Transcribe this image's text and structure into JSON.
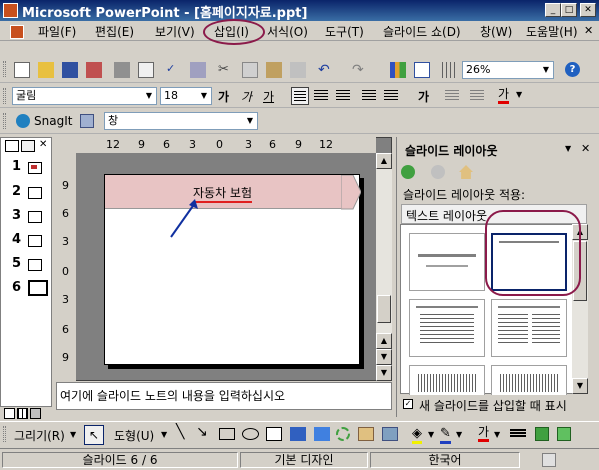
{
  "window": {
    "title": "Microsoft PowerPoint - [홈페이지자료.ppt]"
  },
  "menu": [
    "파일(F)",
    "편집(E)",
    "보기(V)",
    "삽입(I)",
    "서식(O)",
    "도구(T)",
    "슬라이드 쇼(D)",
    "창(W)",
    "도움말(H)"
  ],
  "toolbar": {
    "zoom": "26%",
    "font": "굴림",
    "size": "18",
    "bold": "가",
    "italic": "가",
    "underline": "가",
    "shadow": "가",
    "grow": "가",
    "fontcolor": "가"
  },
  "snagit": {
    "label": "SnagIt",
    "window_label": "창"
  },
  "rulers": {
    "h": [
      "12",
      "9",
      "6",
      "3",
      "0",
      "3",
      "6",
      "9",
      "12"
    ],
    "v": [
      "9",
      "6",
      "3",
      "0",
      "3",
      "6",
      "9"
    ]
  },
  "thumbs": [
    "1",
    "2",
    "3",
    "4",
    "5",
    "6"
  ],
  "slide": {
    "title": "자동차 보험"
  },
  "notes": {
    "placeholder": "여기에 슬라이드 노트의 내용을 입력하십시오"
  },
  "taskpane": {
    "title": "슬라이드 레이아웃",
    "apply_label": "슬라이드 레이아웃 적용:",
    "group": "텍스트 레이아웃",
    "checkbox": "새 슬라이드를 삽입할 때 표시"
  },
  "drawbar": {
    "draw": "그리기(R)",
    "autoshape": "도형(U)",
    "fontcolor": "가"
  },
  "status": {
    "slide": "슬라이드 6 / 6",
    "design": "기본 디자인",
    "lang": "한국어"
  }
}
